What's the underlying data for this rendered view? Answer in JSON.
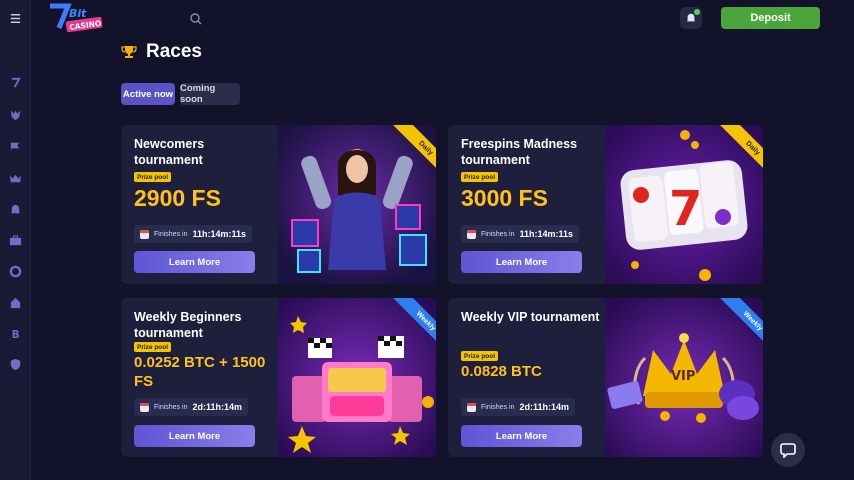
{
  "header": {
    "logo_text": "7Bit Casino",
    "deposit_label": "Deposit"
  },
  "sidebar": {
    "icons": [
      "menu-icon",
      "seven-icon",
      "wolf-icon",
      "flag-icon",
      "crown-icon",
      "bell-icon",
      "briefcase-icon",
      "lifebuoy-icon",
      "home-icon",
      "bitcoin-icon",
      "shield-icon"
    ]
  },
  "page": {
    "title": "Races",
    "tabs": [
      {
        "label": "Active now",
        "active": true
      },
      {
        "label": "Coming soon",
        "active": false
      }
    ]
  },
  "cards": [
    {
      "title": "Newcomers tournament",
      "prize_label": "Prize pool",
      "prize": "2900 FS",
      "finish_label": "Finishes in",
      "timer": "11h:14m:11s",
      "button": "Learn More",
      "ribbon": "Daily"
    },
    {
      "title": "Freespins Madness tournament",
      "prize_label": "Prize pool",
      "prize": "3000 FS",
      "finish_label": "Finishes in",
      "timer": "11h:14m:11s",
      "button": "Learn More",
      "ribbon": "Daily"
    },
    {
      "title": "Weekly Beginners tournament",
      "prize_label": "Prize pool",
      "prize": "0.0252 BTC + 1500 FS",
      "finish_label": "Finishes in",
      "timer": "2d:11h:14m",
      "button": "Learn More",
      "ribbon": "Weekly"
    },
    {
      "title": "Weekly VIP tournament",
      "prize_label": "Prize pool",
      "prize": "0.0828 BTC",
      "finish_label": "Finishes in",
      "timer": "2d:11h:14m",
      "button": "Learn More",
      "ribbon": "Weekly"
    }
  ],
  "colors": {
    "background": "#12122b",
    "card": "#1e1f3d",
    "accent": "#5a53c8",
    "prize": "#ffc21a",
    "deposit": "#4aa63a"
  }
}
